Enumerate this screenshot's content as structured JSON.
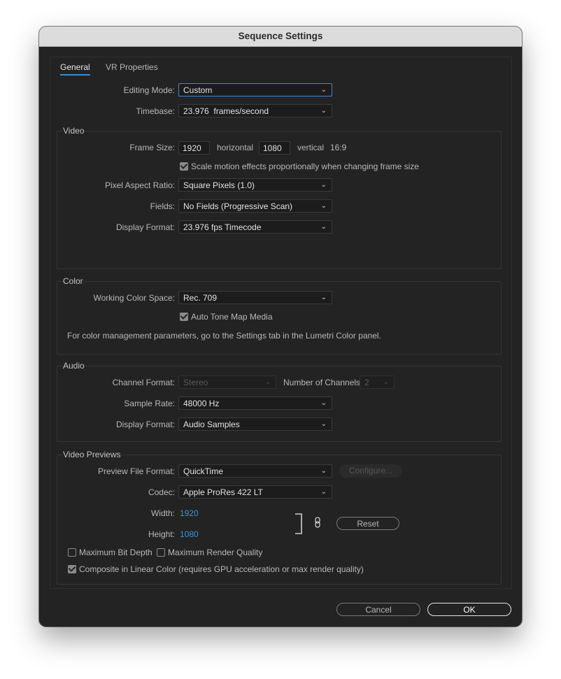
{
  "window": {
    "title": "Sequence Settings"
  },
  "tabs": [
    "General",
    "VR Properties"
  ],
  "general": {
    "editing_mode": {
      "label": "Editing Mode:",
      "value": "Custom"
    },
    "timebase": {
      "label": "Timebase:",
      "value": "23.976  frames/second"
    }
  },
  "video": {
    "legend": "Video",
    "frame_size_label": "Frame Size:",
    "frame_width": "1920",
    "horizontal_label": "horizontal",
    "frame_height": "1080",
    "vertical_label": "vertical",
    "aspect": "16:9",
    "scale_motion": {
      "label": "Scale motion effects proportionally when changing frame size",
      "checked": true
    },
    "pixel_aspect": {
      "label": "Pixel Aspect Ratio:",
      "value": "Square Pixels (1.0)"
    },
    "fields": {
      "label": "Fields:",
      "value": "No Fields (Progressive Scan)"
    },
    "display_format": {
      "label": "Display Format:",
      "value": "23.976 fps Timecode"
    }
  },
  "color": {
    "legend": "Color",
    "working_space": {
      "label": "Working Color Space:",
      "value": "Rec. 709"
    },
    "auto_tone": {
      "label": "Auto Tone Map Media",
      "checked": true
    },
    "note": "For color management parameters, go to the Settings tab in the Lumetri Color panel."
  },
  "audio": {
    "legend": "Audio",
    "channel_format": {
      "label": "Channel Format:",
      "value": "Stereo"
    },
    "num_channels": {
      "label": "Number of Channels:",
      "value": "2"
    },
    "sample_rate": {
      "label": "Sample Rate:",
      "value": "48000 Hz"
    },
    "display_format": {
      "label": "Display Format:",
      "value": "Audio Samples"
    }
  },
  "previews": {
    "legend": "Video Previews",
    "file_format": {
      "label": "Preview File Format:",
      "value": "QuickTime"
    },
    "configure_label": "Configure...",
    "codec": {
      "label": "Codec:",
      "value": "Apple ProRes 422 LT"
    },
    "width": {
      "label": "Width:",
      "value": "1920"
    },
    "height": {
      "label": "Height:",
      "value": "1080"
    },
    "reset_label": "Reset",
    "max_bit_depth": {
      "label": "Maximum Bit Depth",
      "checked": false
    },
    "max_render": {
      "label": "Maximum Render Quality",
      "checked": false
    },
    "linear_color": {
      "label": "Composite in Linear Color (requires GPU acceleration or max render quality)",
      "checked": true
    }
  },
  "footer": {
    "cancel_label": "Cancel",
    "ok_label": "OK"
  },
  "colors": {
    "accent": "#2f8ee6",
    "link": "#3a93e0",
    "panel": "#232323",
    "titlebar": "#dcdcdc"
  },
  "icons": [
    "chevron-down-icon",
    "checkmark-icon",
    "link-icon",
    "bracket-icon"
  ]
}
